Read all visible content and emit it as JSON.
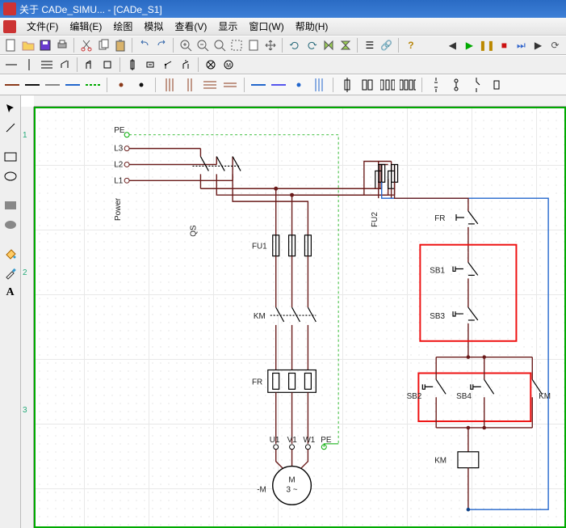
{
  "window": {
    "title": "关于 CADe_SIMU... - [CADe_S1]"
  },
  "menus": {
    "file": "文件(F)",
    "edit": "编辑(E)",
    "draw": "绘图",
    "sim": "模拟",
    "view": "查看(V)",
    "display": "显示",
    "window": "窗口(W)",
    "help": "帮助(H)"
  },
  "schematic": {
    "phases": {
      "pe": "PE",
      "l3": "L3",
      "l2": "L2",
      "l1": "L1",
      "power": "Power"
    },
    "components": {
      "qs": "QS",
      "fu1": "FU1",
      "km_main": "KM",
      "fr_main": "FR",
      "u1": "U1",
      "v1": "V1",
      "w1": "W1",
      "pe2": "PE",
      "motor_label": "M",
      "motor_sub": "3    ~",
      "motor_neg": "-M",
      "fu2": "FU2",
      "fr_ctrl": "FR",
      "sb1": "SB1",
      "sb3": "SB3",
      "sb2": "SB2",
      "sb4": "SB4",
      "km_par": "KM",
      "km_coil": "KM"
    }
  },
  "ruler_marks": [
    "1",
    "2",
    "3"
  ],
  "icons": {
    "play": "▶",
    "pause": "❚❚",
    "stop": "■",
    "step1": "⏮",
    "step2": "⏭",
    "prev": "◀",
    "next": "▶"
  }
}
